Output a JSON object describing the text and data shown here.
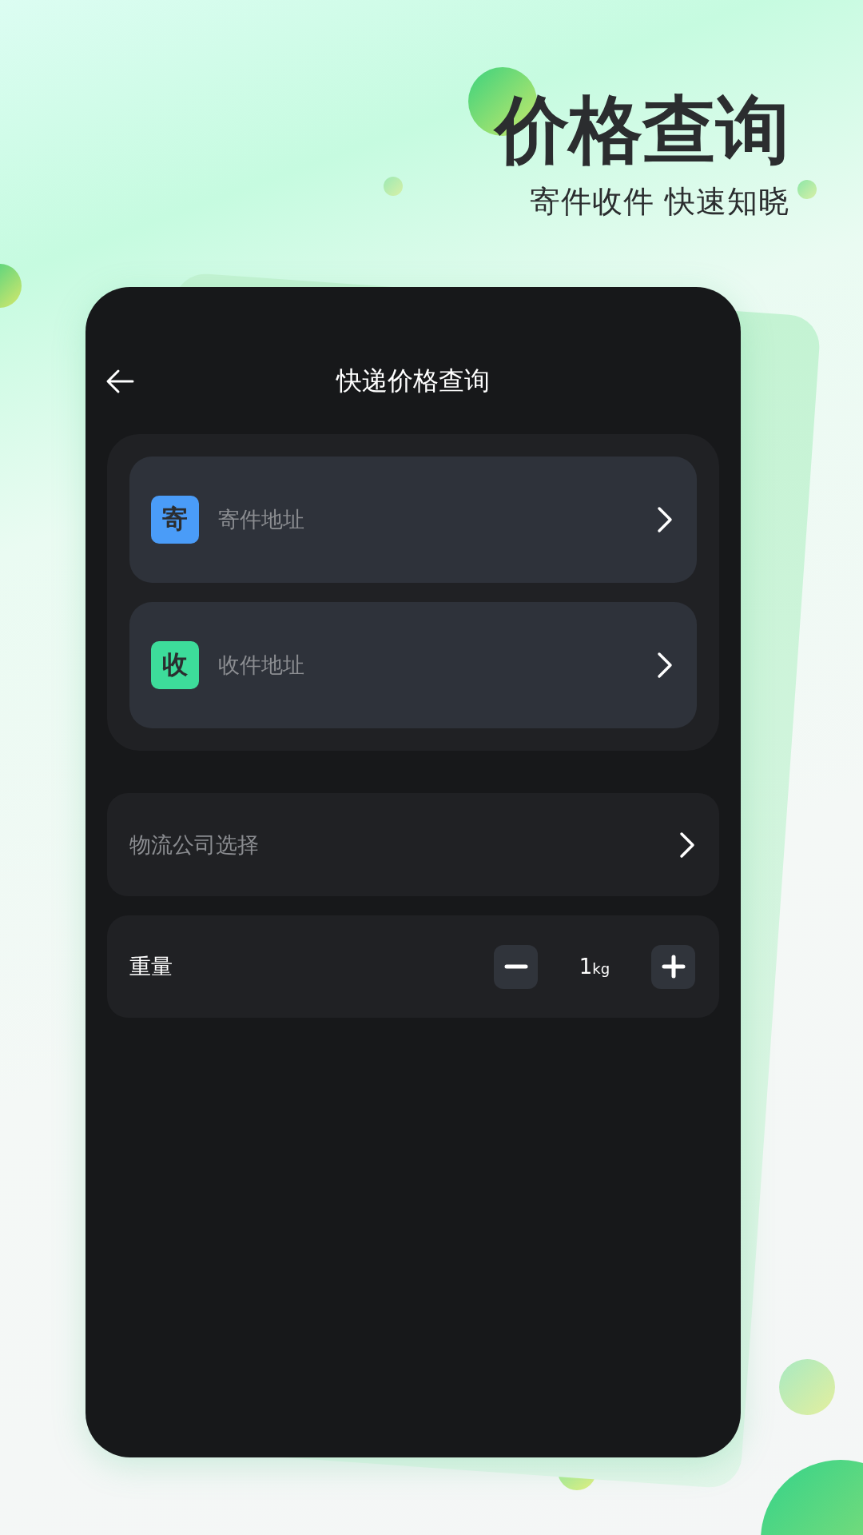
{
  "promo": {
    "headline": "价格查询",
    "subtitle": "寄件收件 快速知晓"
  },
  "screen": {
    "title": "快递价格查询",
    "addresses": [
      {
        "badge": "寄",
        "color": "#4a9cf8",
        "placeholder": "寄件地址"
      },
      {
        "badge": "收",
        "color": "#3ddc9a",
        "placeholder": "收件地址"
      }
    ],
    "company": {
      "placeholder": "物流公司选择"
    },
    "weight": {
      "label": "重量",
      "value": "1",
      "unit": "kg"
    }
  }
}
